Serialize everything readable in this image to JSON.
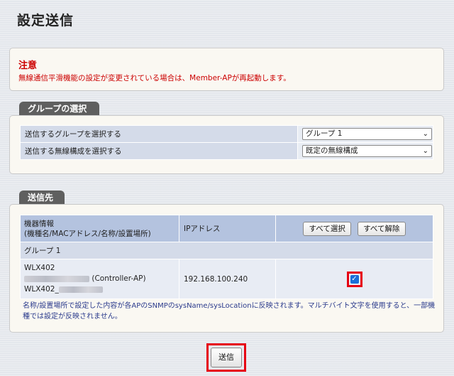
{
  "page": {
    "title": "設定送信"
  },
  "notice": {
    "title": "注意",
    "text": "無線通信平滑機能の設定が変更されている場合は、Member-APが再起動します。"
  },
  "group_section": {
    "tab_label": "グループの選択",
    "rows": [
      {
        "label": "送信するグループを選択する",
        "value": "グループ 1"
      },
      {
        "label": "送信する無線構成を選択する",
        "value": "既定の無線構成"
      }
    ]
  },
  "dest_section": {
    "tab_label": "送信先",
    "header": {
      "device_info_line1": "機器情報",
      "device_info_line2": "(機種名/MACアドレス/名称/設置場所)",
      "ip_label": "IPアドレス",
      "select_all": "すべて選択",
      "deselect_all": "すべて解除"
    },
    "group_name": "グループ 1",
    "device": {
      "model": "WLX402",
      "role": "(Controller-AP)",
      "name_prefix": "WLX402_",
      "ip": "192.168.100.240",
      "checked": true
    },
    "note": "名称/設置場所で設定した内容が各APのSNMPのsysName/sysLocationに反映されます。マルチバイト文字を使用すると、一部機種では設定が反映されません。"
  },
  "send_button": "送信",
  "colors": {
    "accent": "#e60012",
    "tab": "#5f5f5f",
    "header_row": "#b4c3df",
    "notice_text": "#cc0000"
  }
}
